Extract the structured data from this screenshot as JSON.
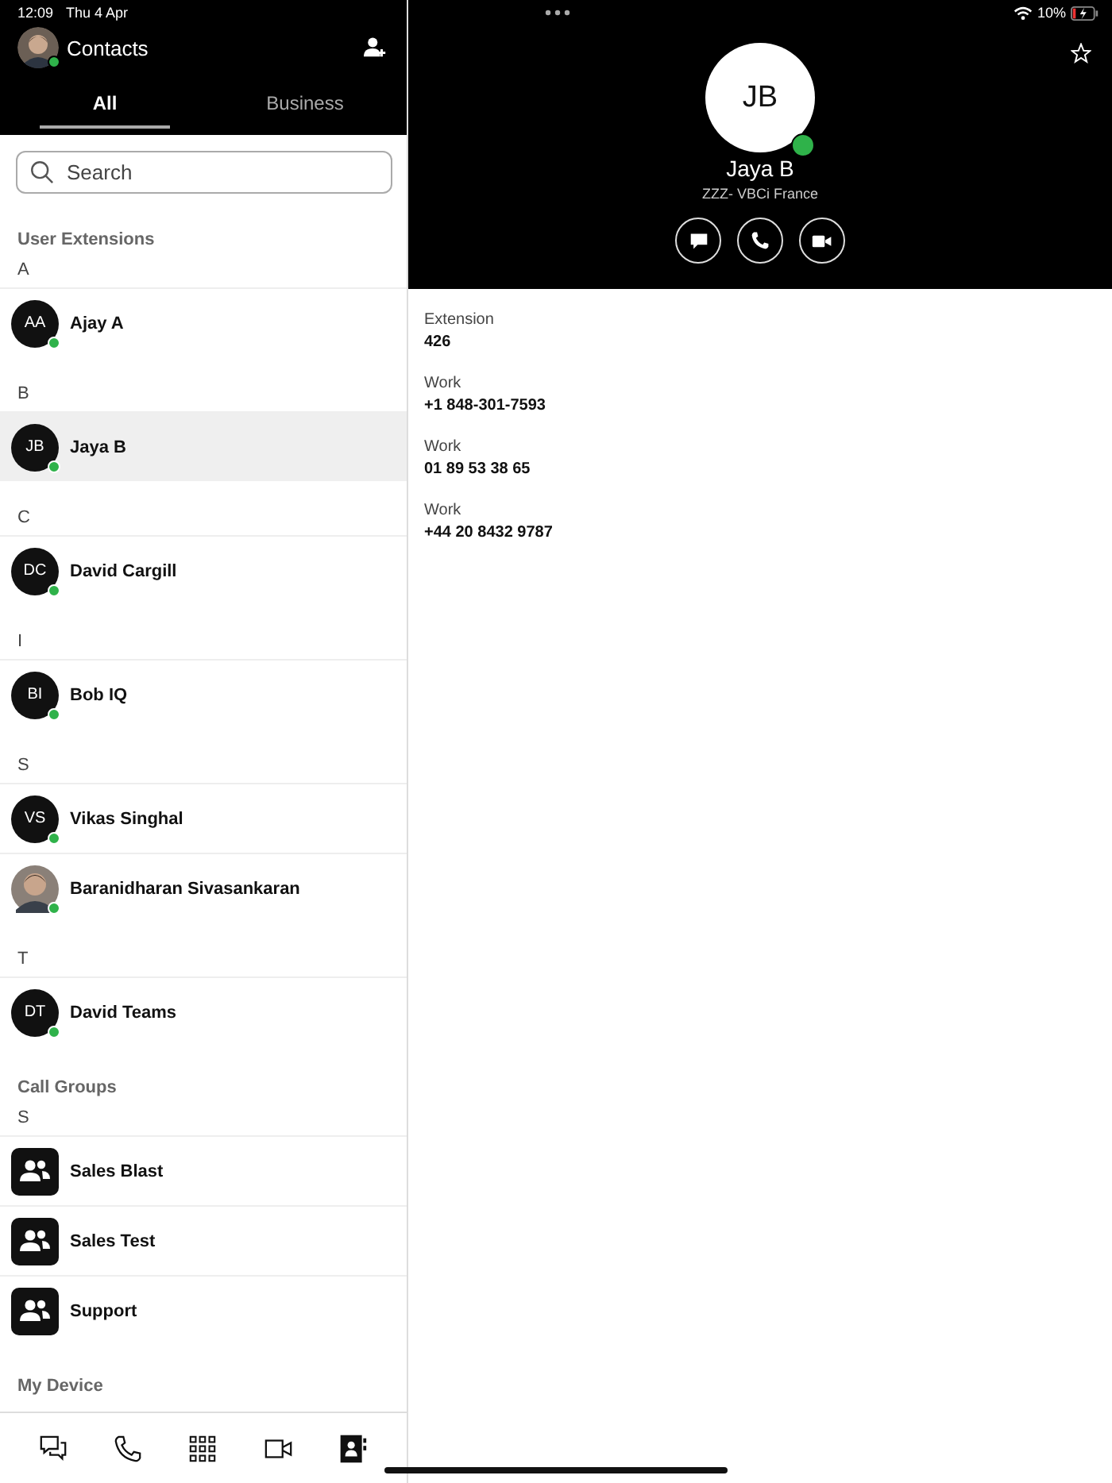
{
  "status_bar": {
    "time": "12:09",
    "date": "Thu 4 Apr",
    "battery": "10%",
    "charging": true
  },
  "header": {
    "title": "Contacts",
    "online": true
  },
  "tabs": [
    {
      "label": "All",
      "selected": true
    },
    {
      "label": "Business",
      "selected": false
    }
  ],
  "search": {
    "placeholder": "Search"
  },
  "sections": [
    {
      "title": "User Extensions",
      "groups": [
        {
          "letter": "A",
          "contacts": [
            {
              "kind": "initials",
              "initials": "AA",
              "name": "Ajay A",
              "online": true,
              "selected": false
            }
          ]
        },
        {
          "letter": "B",
          "contacts": [
            {
              "kind": "initials",
              "initials": "JB",
              "name": "Jaya B",
              "online": true,
              "selected": true
            }
          ]
        },
        {
          "letter": "C",
          "contacts": [
            {
              "kind": "initials",
              "initials": "DC",
              "name": "David Cargill",
              "online": true,
              "selected": false
            }
          ]
        },
        {
          "letter": "I",
          "contacts": [
            {
              "kind": "initials",
              "initials": "BI",
              "name": "Bob IQ",
              "online": true,
              "selected": false
            }
          ]
        },
        {
          "letter": "S",
          "contacts": [
            {
              "kind": "initials",
              "initials": "VS",
              "name": "Vikas Singhal",
              "online": true,
              "selected": false
            },
            {
              "name": "Baranidharan Sivasankaran",
              "online": true,
              "selected": false
            }
          ]
        },
        {
          "letter": "T",
          "contacts": [
            {
              "kind": "initials",
              "initials": "DT",
              "name": "David Teams",
              "online": true,
              "selected": false
            }
          ]
        }
      ]
    },
    {
      "title": "Call Groups",
      "groups": [
        {
          "letter": "S",
          "contacts": [
            {
              "kind": "group",
              "name": "Sales Blast",
              "selected": false
            },
            {
              "kind": "group",
              "name": "Sales Test",
              "selected": false
            },
            {
              "kind": "group",
              "name": "Support",
              "selected": false
            }
          ]
        }
      ]
    },
    {
      "title": "My Device"
    }
  ],
  "bottom_nav": [
    {
      "kind": "chat",
      "selected": false
    },
    {
      "kind": "phone",
      "selected": false
    },
    {
      "kind": "keypad",
      "selected": false
    },
    {
      "kind": "video",
      "selected": false
    },
    {
      "kind": "contacts",
      "selected": true
    }
  ],
  "detail": {
    "initials": "JB",
    "online": true,
    "name": "Jaya B",
    "company": "ZZZ- VBCi France",
    "favorite": false,
    "actions": [
      {
        "kind": "chat"
      },
      {
        "kind": "phone"
      },
      {
        "kind": "video"
      }
    ],
    "fields": [
      {
        "label": "Extension",
        "value": "426"
      },
      {
        "label": "Work",
        "value": "+1 848-301-7593"
      },
      {
        "label": "Work",
        "value": "01 89 53 38 65"
      },
      {
        "label": "Work",
        "value": "+44 20 8432 9787"
      }
    ]
  }
}
